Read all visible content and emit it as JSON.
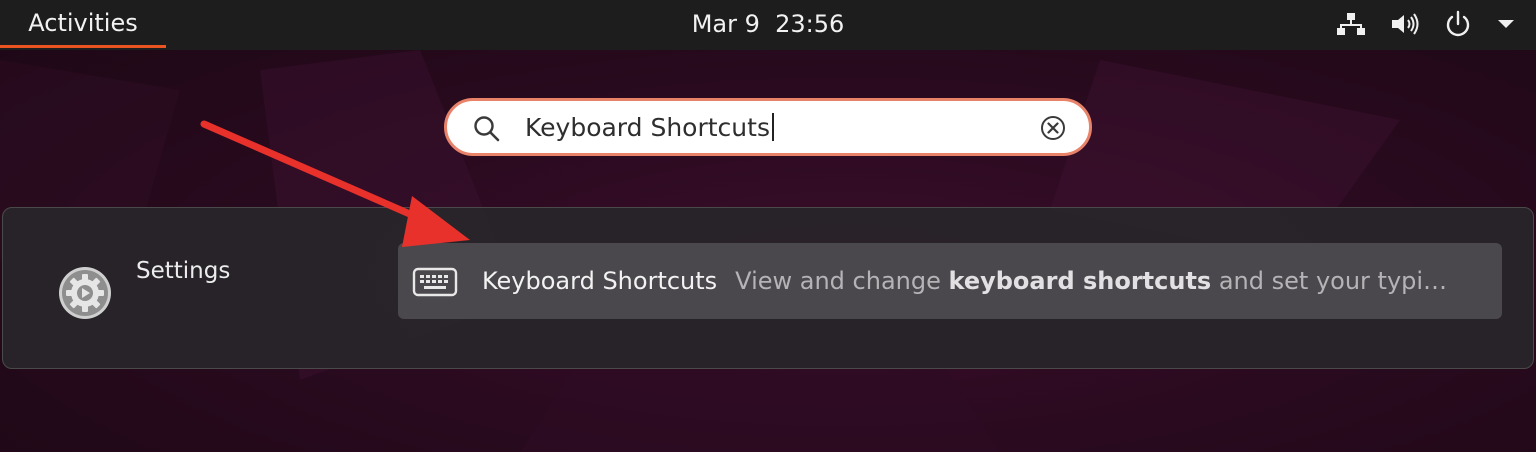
{
  "topbar": {
    "activities_label": "Activities",
    "clock_date": "Mar 9",
    "clock_time": "23:56",
    "tray_icons": [
      "network-icon",
      "volume-icon",
      "power-icon",
      "menu-chevron-down-icon"
    ]
  },
  "search": {
    "value": "Keyboard Shortcuts",
    "icon": "search-icon",
    "clear_icon": "clear-circle-x-icon"
  },
  "results": {
    "provider": {
      "label": "Settings",
      "icon": "settings-gear-icon"
    },
    "items": [
      {
        "icon": "keyboard-icon",
        "title": "Keyboard Shortcuts",
        "description_pre": "View and change ",
        "description_bold": "keyboard shortcuts",
        "description_post": " and set your typi…"
      }
    ]
  },
  "annotation": {
    "type": "arrow",
    "color": "#e8312b"
  },
  "colors": {
    "accent": "#e95420",
    "search_border": "#e8836a",
    "topbar_bg": "#1d1d1d",
    "result_highlight": "#4a484c"
  }
}
